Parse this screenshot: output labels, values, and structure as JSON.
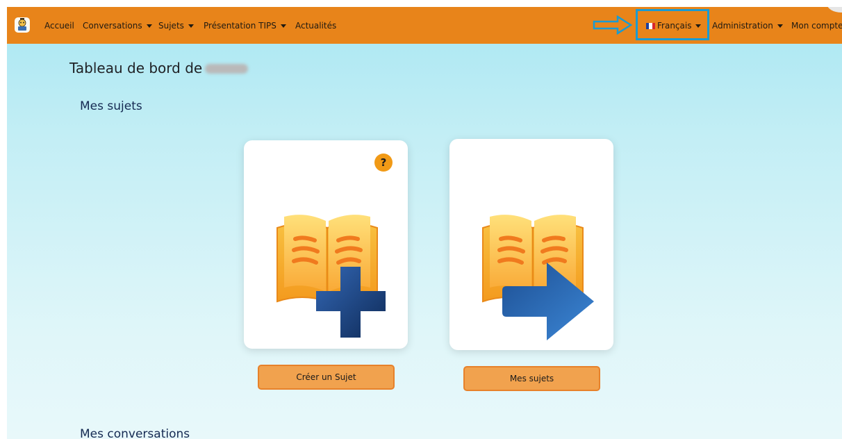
{
  "nav": {
    "items": [
      {
        "label": "Accueil"
      },
      {
        "label": "Conversations"
      },
      {
        "label": "Sujets"
      },
      {
        "label": "Présentation TIPS"
      },
      {
        "label": "Actualités"
      }
    ],
    "language": "Français",
    "admin": "Administration",
    "account": "Mon compte"
  },
  "dashboard": {
    "title_prefix": "Tableau de bord de"
  },
  "sections": {
    "subjects": "Mes sujets",
    "conversations": "Mes conversations"
  },
  "cards": {
    "create": {
      "badge": "?",
      "button": "Créer un Sujet"
    },
    "mine": {
      "button": "Mes sujets"
    }
  },
  "colors": {
    "navbar": "#e8841a",
    "highlight": "#199bd3",
    "button": "#f1a24e",
    "badge": "#f19a16"
  },
  "icons": {
    "logo": "app-logo-icon",
    "create": "book-plus-icon",
    "mine": "book-arrow-icon",
    "annotation": "annotation-arrow-icon",
    "flag": "french-flag-icon"
  }
}
